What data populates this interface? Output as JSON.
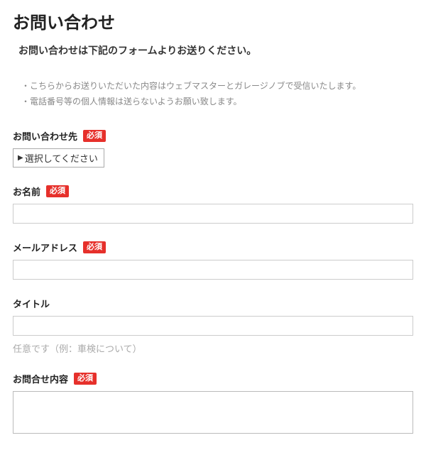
{
  "page": {
    "title": "お問い合わせ",
    "intro": "お問い合わせは下記のフォームよりお送りください。"
  },
  "notes": {
    "line1": "・こちらからお送りいただいた内容はウェブマスターとガレージノブで受信いたします。",
    "line2": "・電話番号等の個人情報は送らないようお願い致します。"
  },
  "labels": {
    "required": "必須",
    "destination": "お問い合わせ先",
    "name": "お名前",
    "email": "メールアドレス",
    "subject": "タイトル",
    "subject_hint": "任意です（例：車検について）",
    "body": "お問合せ内容"
  },
  "fields": {
    "destination_selected": "選択してください",
    "name_value": "",
    "email_value": "",
    "subject_value": "",
    "body_value": ""
  }
}
